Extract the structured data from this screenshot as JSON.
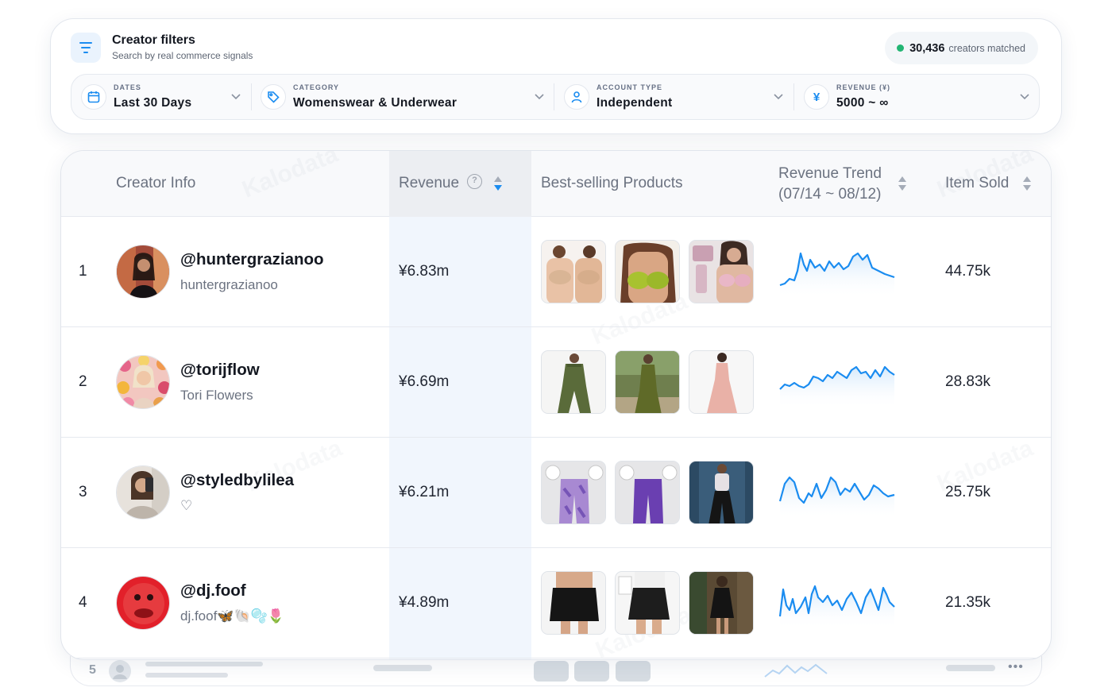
{
  "filters": {
    "title": "Creator filters",
    "subtitle": "Search by real commerce signals",
    "matched_count": "30,436",
    "matched_label": "creators matched",
    "segments": [
      {
        "label": "DATES",
        "value": "Last 30 Days",
        "icon": "calendar-icon"
      },
      {
        "label": "CATEGORY",
        "value": "Womenswear & Underwear",
        "icon": "tag-icon"
      },
      {
        "label": "ACCOUNT TYPE",
        "value": "Independent",
        "icon": "user-icon"
      },
      {
        "label": "REVENUE (¥)",
        "value": "5000 ~ ∞",
        "icon": "yen-icon",
        "glyph": "¥"
      }
    ]
  },
  "table": {
    "headers": {
      "creator": "Creator Info",
      "revenue": "Revenue",
      "help": "?",
      "products": "Best-selling Products",
      "trend_line1": "Revenue Trend",
      "trend_line2": "(07/14 ~ 08/12)",
      "sold": "Item Sold"
    },
    "rows": [
      {
        "rank": "1",
        "handle": "@huntergrazianoo",
        "nick": "huntergrazianoo",
        "revenue": "¥6.83m",
        "sold": "44.75k"
      },
      {
        "rank": "2",
        "handle": "@torijflow",
        "nick": "Tori Flowers",
        "revenue": "¥6.69m",
        "sold": "28.83k"
      },
      {
        "rank": "3",
        "handle": "@styledbylilea",
        "nick": "♡",
        "revenue": "¥6.21m",
        "sold": "25.75k"
      },
      {
        "rank": "4",
        "handle": "@dj.foof",
        "nick": "dj.foof🦋🐚🫧🌷",
        "revenue": "¥4.89m",
        "sold": "21.35k"
      }
    ],
    "ghost_rank": "5",
    "ghost_more": "•••",
    "watermark": "Kalodata"
  },
  "colors": {
    "accent": "#1a8cf0",
    "status_green": "#22b573"
  }
}
